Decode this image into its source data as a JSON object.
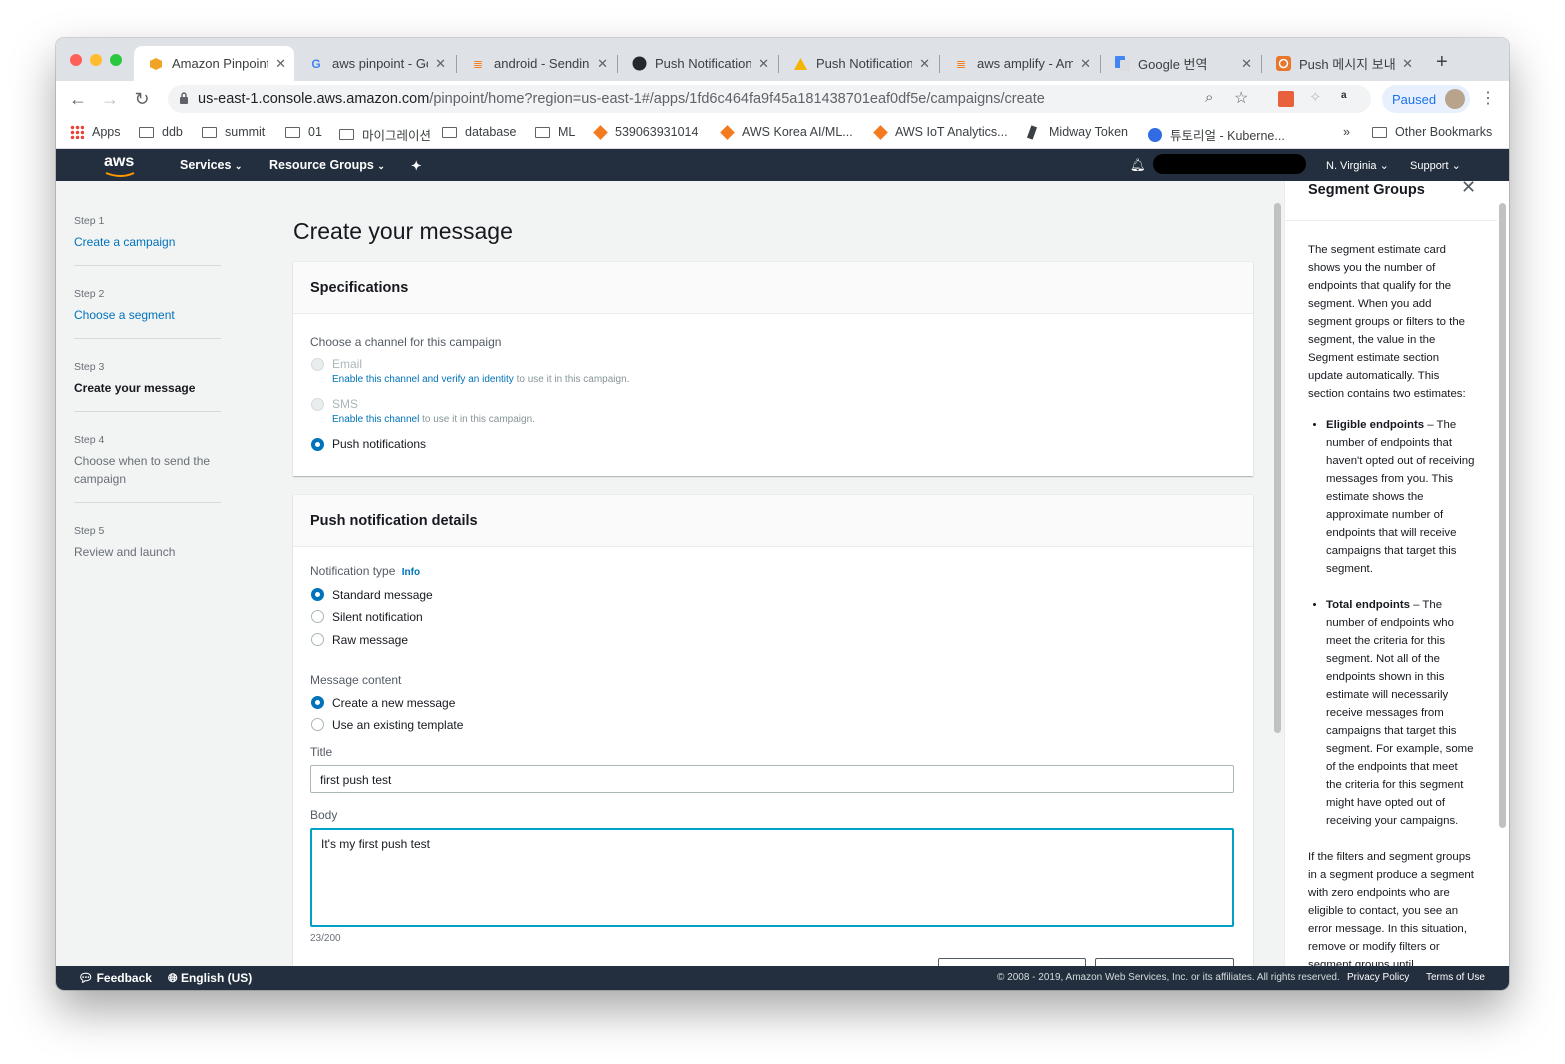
{
  "browser": {
    "tabs": [
      {
        "title": "Amazon Pinpoint",
        "icon": "aws-cube-icon"
      },
      {
        "title": "aws pinpoint - Go",
        "icon": "google-icon"
      },
      {
        "title": "android - Sending",
        "icon": "stackoverflow-icon"
      },
      {
        "title": "Push Notification",
        "icon": "github-icon"
      },
      {
        "title": "Push Notification",
        "icon": "warning-icon"
      },
      {
        "title": "aws amplify - Am",
        "icon": "stackoverflow-icon"
      },
      {
        "title": "Google 번역",
        "icon": "translate-icon"
      },
      {
        "title": "Push 메시지 보내기",
        "icon": "aws-orange-icon"
      }
    ],
    "url_host": "us-east-1.console.aws.amazon.com",
    "url_path": "/pinpoint/home?region=us-east-1#/apps/1fd6c464fa9f45a181438701eaf0df5e/campaigns/create",
    "paused_label": "Paused",
    "bookmarks": [
      "Apps",
      "ddb",
      "summit",
      "01",
      "마이그레이션",
      "database",
      "ML",
      "539063931014",
      "AWS Korea AI/ML...",
      "AWS IoT Analytics...",
      "Midway Token",
      "튜토리얼 - Kuberne..."
    ],
    "bookmarks_more": "»",
    "other_bookmarks": "Other Bookmarks"
  },
  "aws_nav": {
    "logo": "aws",
    "services": "Services",
    "resource_groups": "Resource Groups",
    "region": "N. Virginia",
    "support": "Support"
  },
  "steps": [
    {
      "num": "Step 1",
      "label": "Create a campaign"
    },
    {
      "num": "Step 2",
      "label": "Choose a segment"
    },
    {
      "num": "Step 3",
      "label": "Create your message"
    },
    {
      "num": "Step 4",
      "label": "Choose when to send the campaign"
    },
    {
      "num": "Step 5",
      "label": "Review and launch"
    }
  ],
  "page_title": "Create your message",
  "specifications": {
    "title": "Specifications",
    "channel_label": "Choose a channel for this campaign",
    "email": "Email",
    "email_link": "Enable this channel and verify an identity",
    "email_rest": " to use it in this campaign.",
    "sms": "SMS",
    "sms_link": "Enable this channel",
    "sms_rest": " to use it in this campaign.",
    "push": "Push notifications"
  },
  "push_details": {
    "title": "Push notification details",
    "notification_type_label": "Notification type",
    "info": "Info",
    "types": [
      "Standard message",
      "Silent notification",
      "Raw message"
    ],
    "message_content_label": "Message content",
    "contents": [
      "Create a new message",
      "Use an existing template"
    ],
    "title_label": "Title",
    "title_value": "first push test",
    "body_label": "Body",
    "body_value": "It's my first push test",
    "char_count": "23/200"
  },
  "help_panel": {
    "title": "Segment Groups",
    "intro": "The segment estimate card shows you the number of endpoints that qualify for the segment. When you add segment groups or filters to the segment, the value in the Segment estimate section update automatically. This section contains two estimates:",
    "eligible_term": "Eligible endpoints",
    "eligible_text": " – The number of endpoints that haven't opted out of receiving messages from you. This estimate shows the approximate number of endpoints that will receive campaigns that target this segment.",
    "total_term": "Total endpoints",
    "total_text": " – The number of endpoints who meet the criteria for this segment. Not all of the endpoints shown in this estimate will necessarily receive messages from campaigns that target this segment. For example, some of the endpoints that meet the criteria for this segment might have opted out of receiving your campaigns.",
    "outro": "If the filters and segment groups in a segment produce a segment with zero endpoints who are eligible to contact, you see an error message. In this situation, remove or modify filters or segment groups until"
  },
  "footer": {
    "feedback": "Feedback",
    "language": "English (US)",
    "copyright": "© 2008 - 2019, Amazon Web Services, Inc. or its affiliates. All rights reserved.",
    "privacy": "Privacy Policy",
    "terms": "Terms of Use"
  },
  "colors": {
    "aws_nav": "#232f3e",
    "link": "#0073bb",
    "focus": "#00a1c9"
  }
}
